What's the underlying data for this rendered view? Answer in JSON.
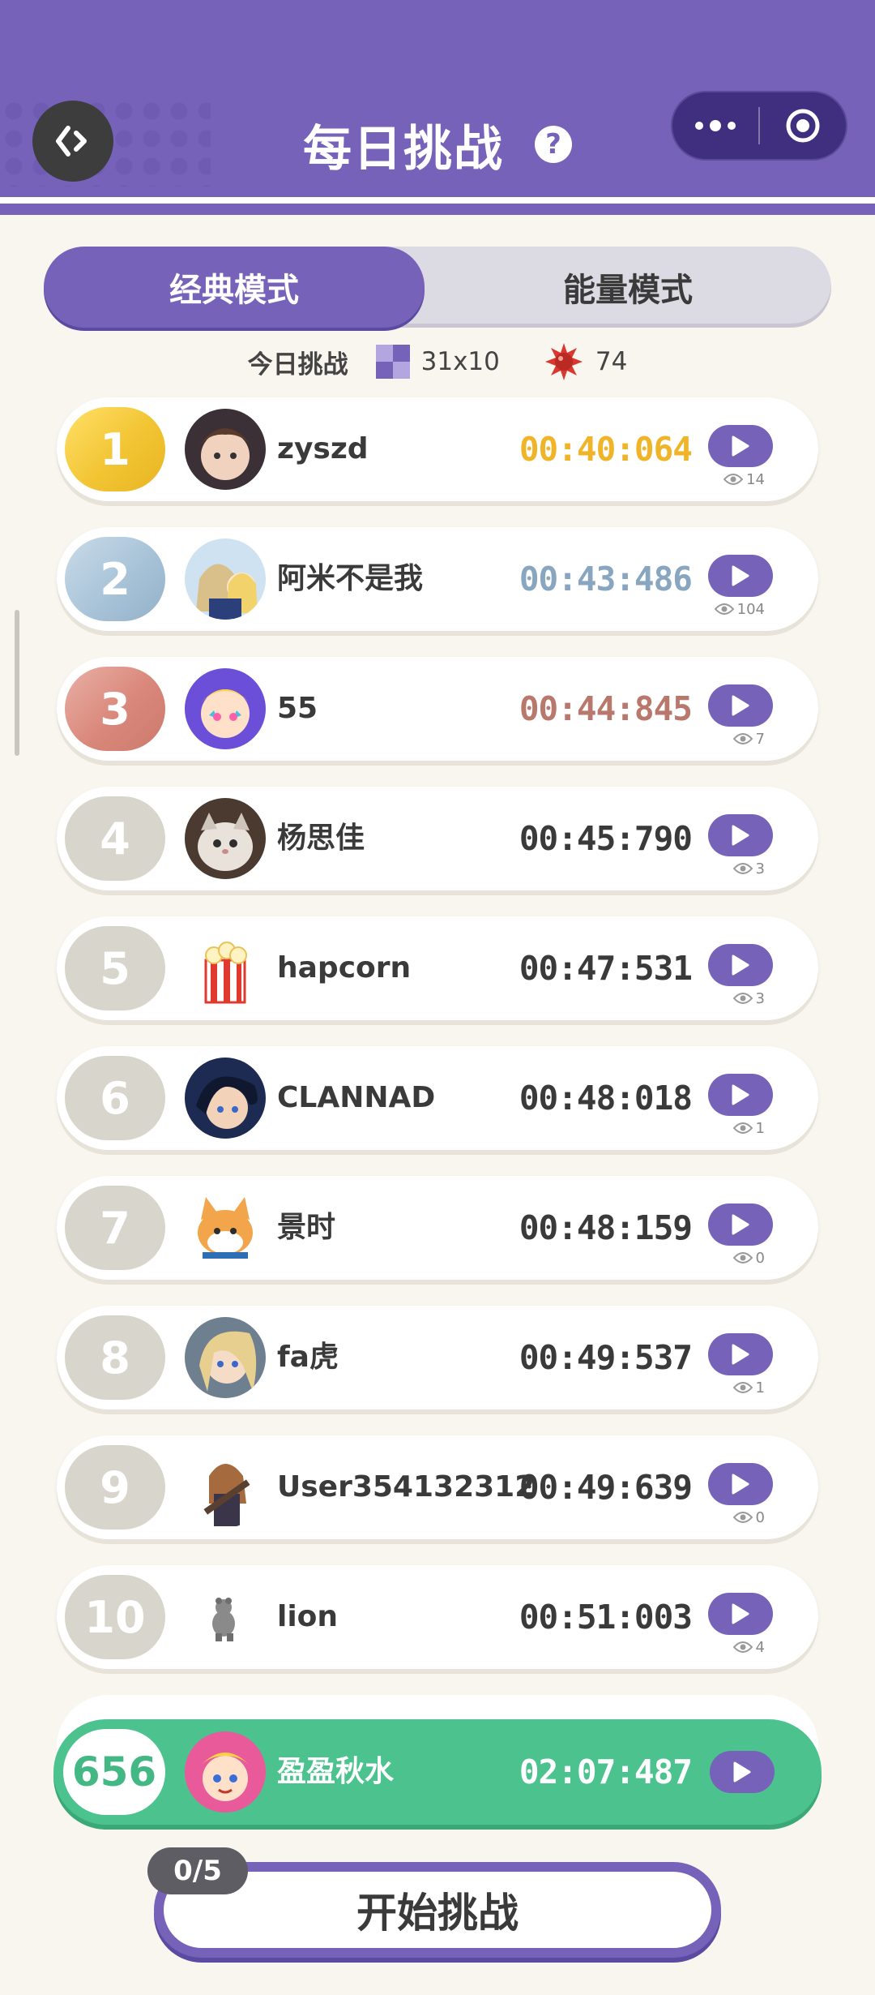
{
  "header": {
    "title": "每日挑战",
    "help_icon": "question-icon",
    "back_icon": "back-arrow-icon",
    "capsule_more_icon": "more-dots-icon",
    "capsule_close_icon": "target-circle-icon",
    "accent_color": "#7762b9"
  },
  "mode_tabs": {
    "active": "经典模式",
    "inactive": "能量模式"
  },
  "daily": {
    "label": "今日挑战",
    "board_size": "31x10",
    "mine_count": "74"
  },
  "leaderboard": [
    {
      "rank": "1",
      "name": "zyszd",
      "time": "00:40:064",
      "views": "14",
      "medal": "gold"
    },
    {
      "rank": "2",
      "name": "阿米不是我",
      "time": "00:43:486",
      "views": "104",
      "medal": "silver"
    },
    {
      "rank": "3",
      "name": "55",
      "time": "00:44:845",
      "views": "7",
      "medal": "bronze"
    },
    {
      "rank": "4",
      "name": "杨思佳",
      "time": "00:45:790",
      "views": "3",
      "medal": "none"
    },
    {
      "rank": "5",
      "name": "hapcorn",
      "time": "00:47:531",
      "views": "3",
      "medal": "none"
    },
    {
      "rank": "6",
      "name": "CLANNAD",
      "time": "00:48:018",
      "views": "1",
      "medal": "none"
    },
    {
      "rank": "7",
      "name": "景时",
      "time": "00:48:159",
      "views": "0",
      "medal": "none"
    },
    {
      "rank": "8",
      "name": "fa虎",
      "time": "00:49:537",
      "views": "1",
      "medal": "none"
    },
    {
      "rank": "9",
      "name": "User354132312",
      "time": "00:49:639",
      "views": "0",
      "medal": "none"
    },
    {
      "rank": "10",
      "name": "lion",
      "time": "00:51:003",
      "views": "4",
      "medal": "none"
    }
  ],
  "my_entry": {
    "rank": "656",
    "name": "盈盈秋水",
    "time": "02:07:487",
    "color": "#4cc38f"
  },
  "start": {
    "label": "开始挑战",
    "attempts": "0/5"
  }
}
